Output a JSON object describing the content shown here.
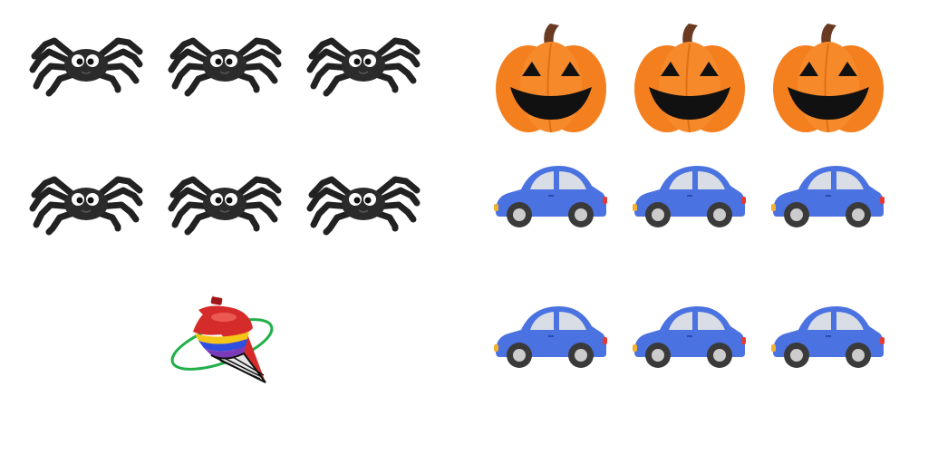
{
  "scene": {
    "background": "#ffffff",
    "groups": [
      {
        "object": "spider",
        "count": 6,
        "icon": "spider-icon",
        "colors": {
          "body": "#2b2b2b",
          "eye": "#ffffff",
          "pupil": "#111111"
        }
      },
      {
        "object": "jack-o-lantern",
        "count": 3,
        "icon": "jack-o-lantern-icon",
        "colors": {
          "body": "#f47f1f",
          "ridge": "#e06f14",
          "stem": "#6b3a22",
          "face": "#111111"
        }
      },
      {
        "object": "car",
        "count": 6,
        "icon": "car-icon",
        "colors": {
          "body": "#4a72e0",
          "window": "#d9dde6",
          "wheel": "#3a3a3a",
          "hub": "#cccccc",
          "taillight": "#e53935",
          "headlight": "#f2b233"
        }
      },
      {
        "object": "spinning-top",
        "count": 1,
        "icon": "spinning-top-icon",
        "colors": {
          "body": "#d62b2b",
          "stripe1": "#f5c518",
          "stripe2": "#2f4fe0",
          "stripe3": "#7b3bb8",
          "orbit": "#22b04a"
        }
      }
    ]
  }
}
